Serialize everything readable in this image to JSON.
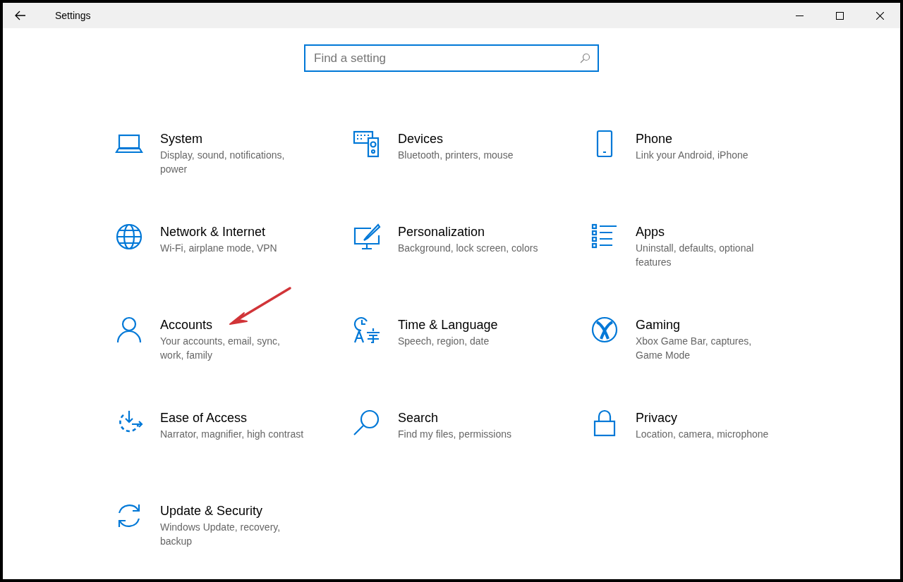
{
  "window": {
    "title": "Settings"
  },
  "search": {
    "placeholder": "Find a setting"
  },
  "categories": [
    {
      "title": "System",
      "subtitle": "Display, sound, notifications, power"
    },
    {
      "title": "Devices",
      "subtitle": "Bluetooth, printers, mouse"
    },
    {
      "title": "Phone",
      "subtitle": "Link your Android, iPhone"
    },
    {
      "title": "Network & Internet",
      "subtitle": "Wi-Fi, airplane mode, VPN"
    },
    {
      "title": "Personalization",
      "subtitle": "Background, lock screen, colors"
    },
    {
      "title": "Apps",
      "subtitle": "Uninstall, defaults, optional features"
    },
    {
      "title": "Accounts",
      "subtitle": "Your accounts, email, sync, work, family"
    },
    {
      "title": "Time & Language",
      "subtitle": "Speech, region, date"
    },
    {
      "title": "Gaming",
      "subtitle": "Xbox Game Bar, captures, Game Mode"
    },
    {
      "title": "Ease of Access",
      "subtitle": "Narrator, magnifier, high contrast"
    },
    {
      "title": "Search",
      "subtitle": "Find my files, permissions"
    },
    {
      "title": "Privacy",
      "subtitle": "Location, camera, microphone"
    },
    {
      "title": "Update & Security",
      "subtitle": "Windows Update, recovery, backup"
    }
  ]
}
